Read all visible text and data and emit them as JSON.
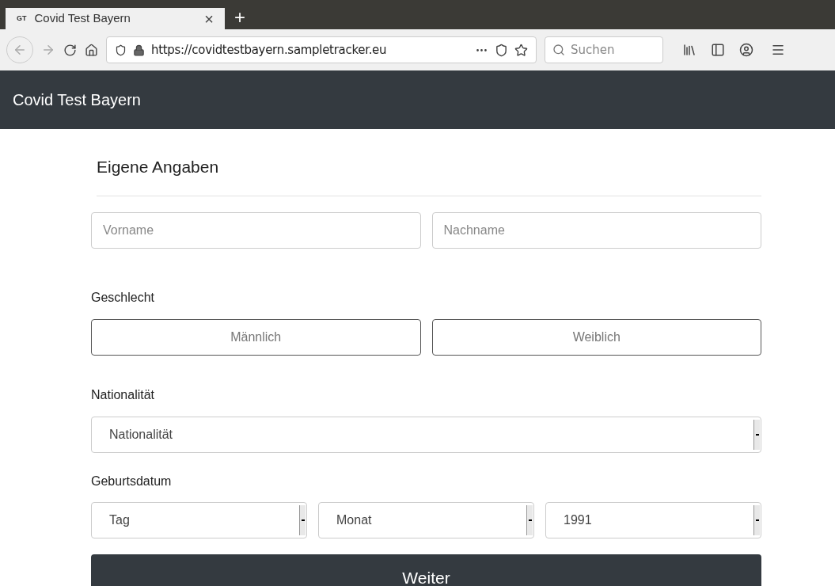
{
  "browser": {
    "tab": {
      "favicon": "GT",
      "title": "Covid Test Bayern",
      "close": "×"
    },
    "new_tab": "+",
    "url": "https://covidtestbayern.sampletracker.eu",
    "search": {
      "placeholder": "Suchen"
    }
  },
  "navbar": {
    "brand": "Covid Test Bayern"
  },
  "form": {
    "heading": "Eigene Angaben",
    "name_fields": [
      {
        "placeholder": "Vorname"
      },
      {
        "placeholder": "Nachname"
      }
    ],
    "gender": {
      "label": "Geschlecht",
      "options": [
        {
          "label": "Männlich",
          "selected": false
        },
        {
          "label": "Weiblich",
          "selected": false
        }
      ]
    },
    "nationality": {
      "label": "Nationalität",
      "value": "Nationalität"
    },
    "birthdate": {
      "label": "Geburtsdatum",
      "selects": [
        {
          "value": "Tag"
        },
        {
          "value": "Monat"
        },
        {
          "value": "1991"
        }
      ]
    },
    "submit": "Weiter"
  }
}
